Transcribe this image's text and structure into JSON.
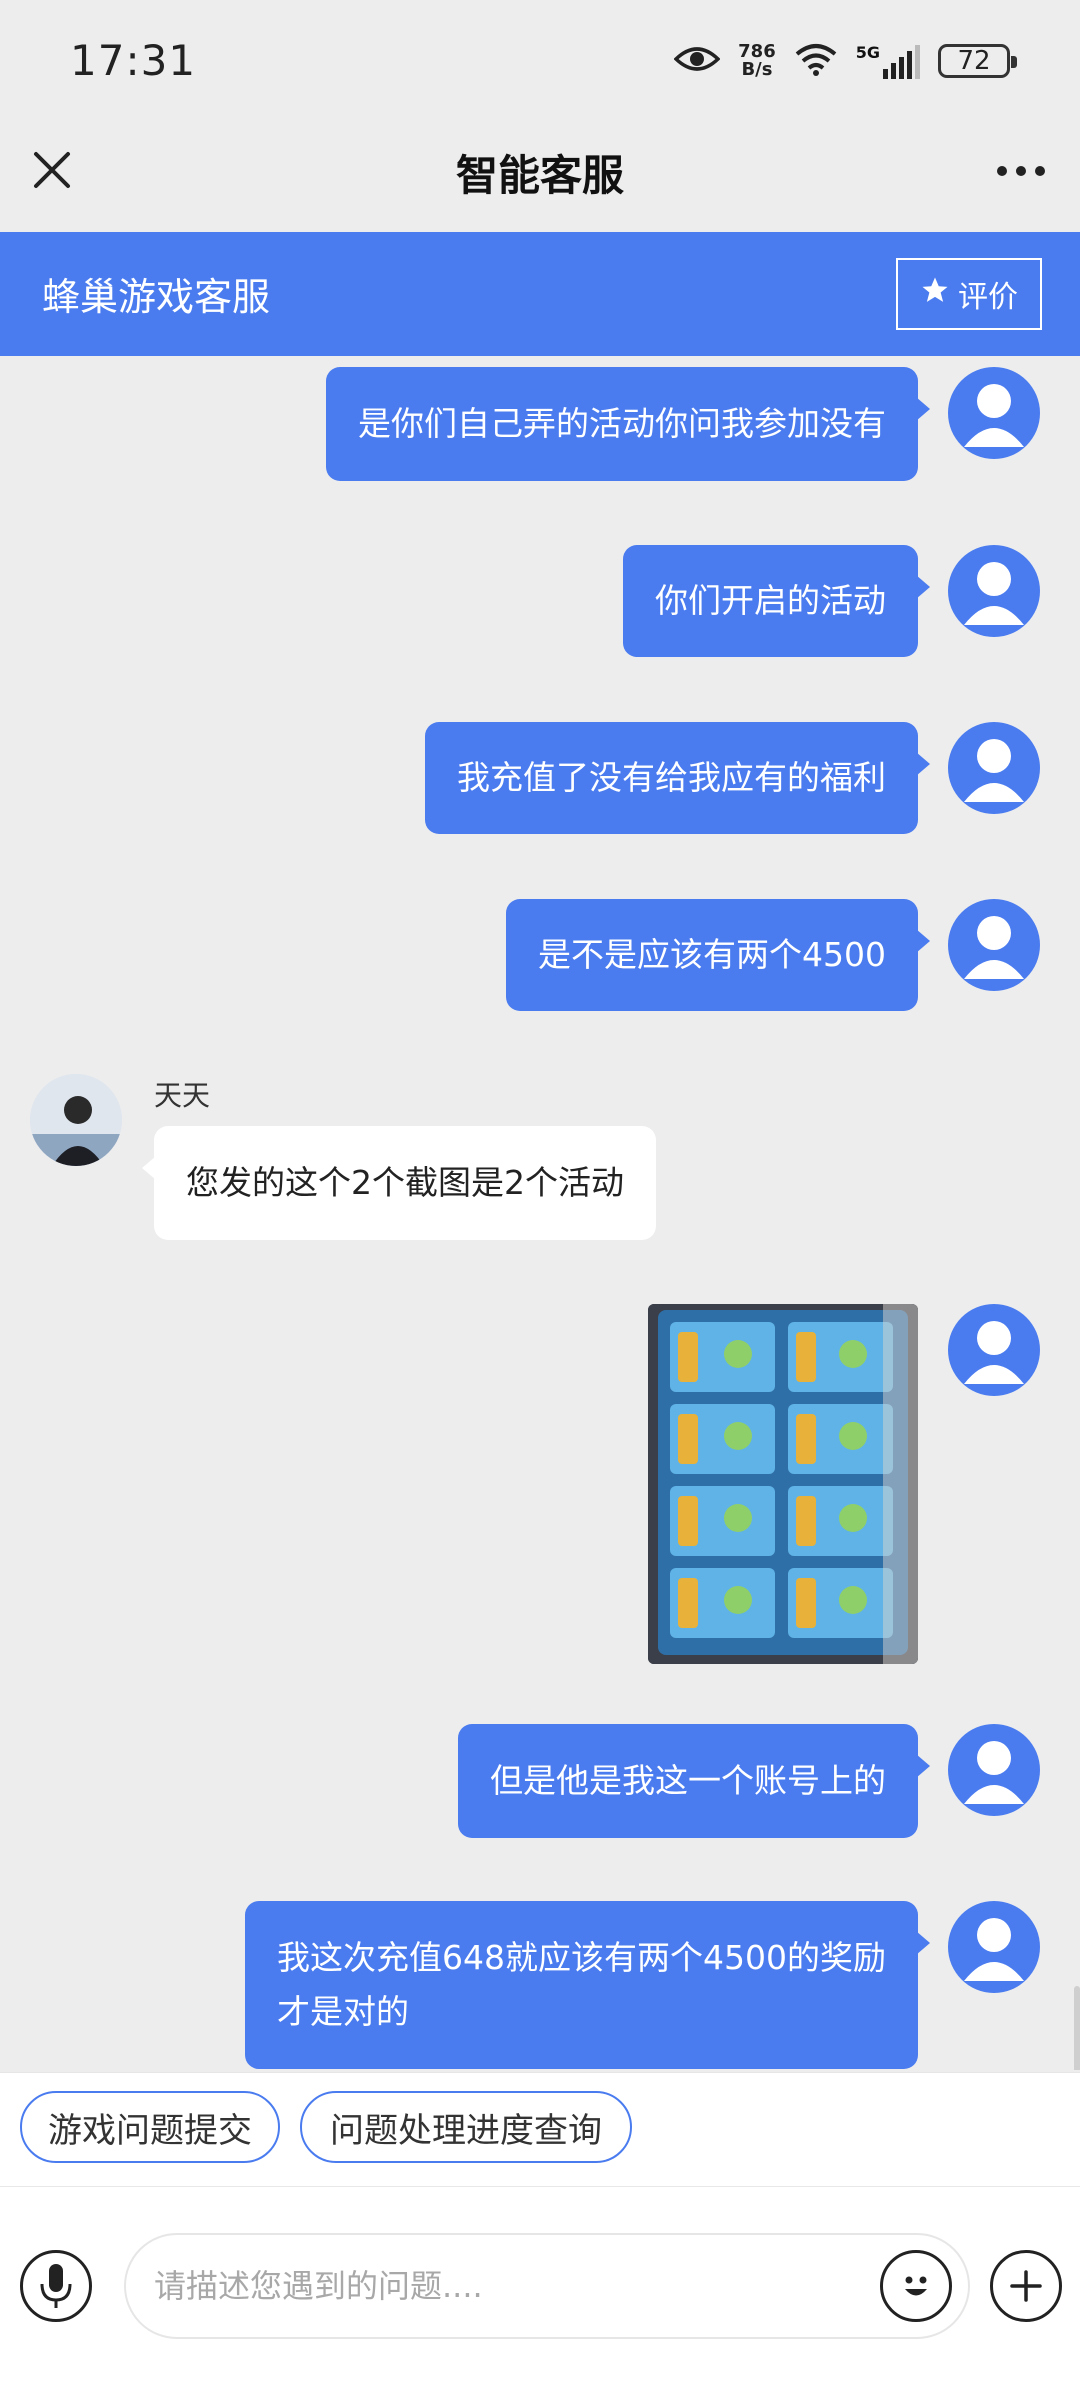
{
  "status_bar": {
    "time": "17:31",
    "net_speed_value": "786",
    "net_speed_unit": "B/s",
    "network": "5G",
    "battery": "72",
    "icons": [
      "eye-icon",
      "wifi-icon",
      "signal-icon",
      "battery-icon"
    ]
  },
  "nav": {
    "title": "智能客服",
    "close_icon": "close-icon",
    "more_icon": "more-icon"
  },
  "header": {
    "title": "蜂巢游戏客服",
    "rate_label": "评价",
    "rate_icon": "star-icon"
  },
  "messages": [
    {
      "from": "user",
      "text": "是你们自己弄的活动你问我参加没有"
    },
    {
      "from": "user",
      "text": "你们开启的活动"
    },
    {
      "from": "user",
      "text": "我充值了没有给我应有的福利"
    },
    {
      "from": "user",
      "text": "是不是应该有两个4500"
    },
    {
      "from": "agent",
      "name": "天天",
      "text": "您发的这个2个截图是2个活动"
    },
    {
      "from": "user",
      "type": "image"
    },
    {
      "from": "user",
      "text": "但是他是我这一个账号上的"
    },
    {
      "from": "user",
      "text_line1": "我这次充值648就应该有两个4500的奖励",
      "text_line2": "才是对的"
    }
  ],
  "quick_actions": [
    "游戏问题提交",
    "问题处理进度查询"
  ],
  "input": {
    "placeholder": "请描述您遇到的问题...."
  },
  "colors": {
    "accent": "#4a7cf0",
    "background": "#ededed"
  }
}
